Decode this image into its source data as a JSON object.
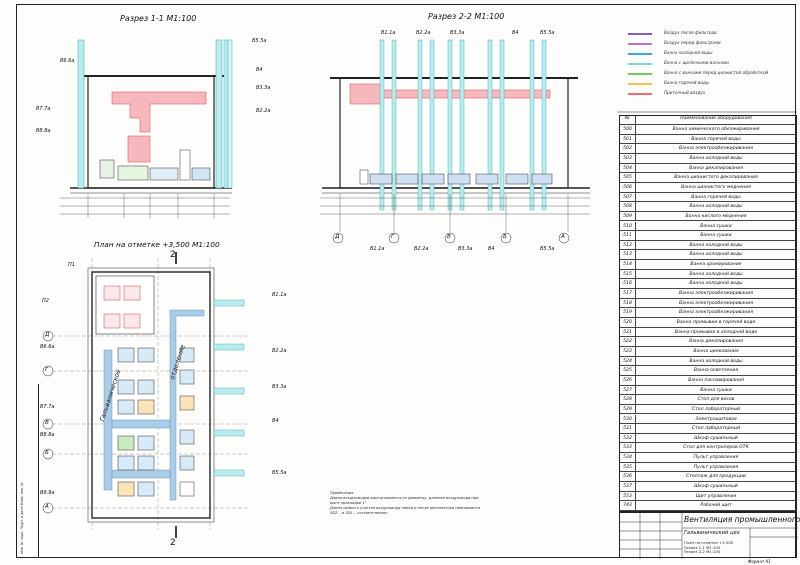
{
  "titles": {
    "section11": "Разрез 1-1     М1:100",
    "section22": "Разрез 2-2     М1:100",
    "plan": "План на отметке +3,500     М1:100"
  },
  "section_marks": {
    "cut": "2"
  },
  "riser_labels_s11": [
    "В6.6а",
    "В5.5а",
    "В4",
    "В3.3а",
    "В2.2а",
    "В7.7а",
    "В8.8а"
  ],
  "riser_labels_s22": [
    "В1.1а",
    "В2.2а",
    "В3.3а",
    "В4",
    "В5.5а"
  ],
  "riser_labels_s22_bottom": [
    "В1.1а",
    "В2.2а",
    "В3.3а",
    "В4",
    "В5.5а"
  ],
  "axes_s22": [
    "Д",
    "Г",
    "В",
    "Б",
    "А"
  ],
  "axes_plan_left": [
    "Д",
    "Г",
    "В",
    "Б",
    "А"
  ],
  "plan_side_labels_left": [
    "П1",
    "П2",
    "В6.6а",
    "В7.7а",
    "В8.8а",
    "В9.9а"
  ],
  "plan_side_labels_right": [
    "В1.1а",
    "В2.2а",
    "В3.3а",
    "В4",
    "В5.5а"
  ],
  "plan_room_labels": [
    "Гальваническое",
    "отделение"
  ],
  "legend": [
    {
      "label": "Воздух после фильтров",
      "color": "#8a5cc9"
    },
    {
      "label": "Воздух перед фильтрами",
      "color": "#c56fc1"
    },
    {
      "label": "Ванна холодной воды",
      "color": "#3fa7d6"
    },
    {
      "label": "Ванна с щелочными ваннами",
      "color": "#7fd3e3"
    },
    {
      "label": "Ванна с ваннами перед цианистой обработкой",
      "color": "#6fcf5a"
    },
    {
      "label": "Ванна горячей воды",
      "color": "#f2c14e"
    },
    {
      "label": "Приточный воздух",
      "color": "#f26d6d"
    }
  ],
  "table": {
    "header_no": "№",
    "header_name": "Наименование оборудования",
    "rows": [
      [
        "500",
        "Ванна химического обезжиривания"
      ],
      [
        "501",
        "Ванна горячей воды"
      ],
      [
        "502",
        "Ванна электрообезжиривания"
      ],
      [
        "503",
        "Ванна холодной воды"
      ],
      [
        "504",
        "Ванна декапирования"
      ],
      [
        "505",
        "Ванна цианистого декапирования"
      ],
      [
        "506",
        "Ванна цианистого меднения"
      ],
      [
        "507",
        "Ванна горячей воды"
      ],
      [
        "508",
        "Ванна холодной воды"
      ],
      [
        "509",
        "Ванна кислого меднения"
      ],
      [
        "510",
        "Ванна сушки"
      ],
      [
        "511",
        "Ванна сушки"
      ],
      [
        "512",
        "Ванна холодной воды"
      ],
      [
        "513",
        "Ванна холодной воды"
      ],
      [
        "514",
        "Ванна хромирования"
      ],
      [
        "515",
        "Ванна холодной воды"
      ],
      [
        "516",
        "Ванна холодной воды"
      ],
      [
        "517",
        "Ванна электрообезжиривания"
      ],
      [
        "518",
        "Ванна электрообезжиривания"
      ],
      [
        "519",
        "Ванна электрообезжиривания"
      ],
      [
        "520",
        "Ванна промывки в горячей воде"
      ],
      [
        "521",
        "Ванна промывки в холодной воде"
      ],
      [
        "522",
        "Ванна декапирования"
      ],
      [
        "523",
        "Ванна цинкования"
      ],
      [
        "524",
        "Ванна холодной воды"
      ],
      [
        "525",
        "Ванна осветления"
      ],
      [
        "526",
        "Ванна пассивирования"
      ],
      [
        "527",
        "Ванна сушки"
      ],
      [
        "528",
        "Стол для весов"
      ],
      [
        "529",
        "Стол лабораторный"
      ],
      [
        "530",
        "Электрощитовая"
      ],
      [
        "531",
        "Стол лабораторный"
      ],
      [
        "532",
        "Шкаф сушильный"
      ],
      [
        "533",
        "Стол для контролеров ОТК"
      ],
      [
        "534",
        "Пульт управления"
      ],
      [
        "535",
        "Пульт управления"
      ],
      [
        "536",
        "Стеллаж для продукции"
      ],
      [
        "537",
        "Шкаф сушильный"
      ],
      [
        "553",
        "Щит управления"
      ],
      [
        "743",
        "Рабочий щит"
      ]
    ]
  },
  "stamp": {
    "title": "Вентиляция промышленного здания",
    "subtitle": "Гальванический цех",
    "sheets": [
      "План на отметке +3,500",
      "Разрез 1-1 М1:100",
      "Разрез 2-2 М1:100"
    ],
    "format": "Формат   А1"
  },
  "notes": {
    "heading": "Примечания",
    "line1": "Длина воздуховодов рассчитывается по диаметру, длиннее воздуховода при",
    "line2": "шаге прокладки 1°.",
    "line3": "Длина прямого участка воздуховода перед и после вентилятора принимается",
    "line4": "5D2... и 3D1... соответственно"
  },
  "colors": {
    "duct_supply": "#f4a0a8",
    "duct_exhaust": "#9ec9e8",
    "riser": "#a8e3e6",
    "line": "#222222"
  }
}
